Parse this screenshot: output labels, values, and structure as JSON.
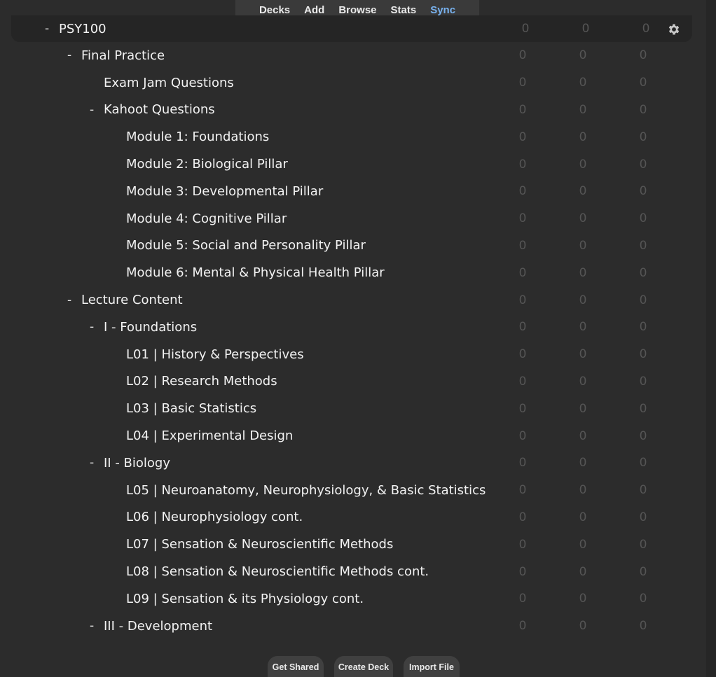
{
  "toolbar": {
    "items": [
      {
        "label": "Decks",
        "active": false
      },
      {
        "label": "Add",
        "active": false
      },
      {
        "label": "Browse",
        "active": false
      },
      {
        "label": "Stats",
        "active": false
      },
      {
        "label": "Sync",
        "active": true
      }
    ]
  },
  "decks": [
    {
      "label": "PSY100",
      "level": 0,
      "expanded": true,
      "counts": [
        "0",
        "0",
        "0"
      ]
    },
    {
      "label": "Final Practice",
      "level": 1,
      "expanded": true,
      "counts": [
        "0",
        "0",
        "0"
      ]
    },
    {
      "label": "Exam Jam Questions",
      "level": 2,
      "expanded": null,
      "counts": [
        "0",
        "0",
        "0"
      ]
    },
    {
      "label": "Kahoot Questions",
      "level": 2,
      "expanded": true,
      "counts": [
        "0",
        "0",
        "0"
      ]
    },
    {
      "label": "Module 1: Foundations",
      "level": 3,
      "expanded": null,
      "counts": [
        "0",
        "0",
        "0"
      ]
    },
    {
      "label": "Module 2: Biological Pillar",
      "level": 3,
      "expanded": null,
      "counts": [
        "0",
        "0",
        "0"
      ]
    },
    {
      "label": "Module 3: Developmental Pillar",
      "level": 3,
      "expanded": null,
      "counts": [
        "0",
        "0",
        "0"
      ]
    },
    {
      "label": "Module 4: Cognitive Pillar",
      "level": 3,
      "expanded": null,
      "counts": [
        "0",
        "0",
        "0"
      ]
    },
    {
      "label": "Module 5: Social and Personality Pillar",
      "level": 3,
      "expanded": null,
      "counts": [
        "0",
        "0",
        "0"
      ]
    },
    {
      "label": "Module 6: Mental & Physical Health Pillar",
      "level": 3,
      "expanded": null,
      "counts": [
        "0",
        "0",
        "0"
      ]
    },
    {
      "label": "Lecture Content",
      "level": 1,
      "expanded": true,
      "counts": [
        "0",
        "0",
        "0"
      ]
    },
    {
      "label": "I - Foundations",
      "level": 2,
      "expanded": true,
      "counts": [
        "0",
        "0",
        "0"
      ]
    },
    {
      "label": "L01 | History & Perspectives",
      "level": 3,
      "expanded": null,
      "counts": [
        "0",
        "0",
        "0"
      ]
    },
    {
      "label": "L02 | Research Methods",
      "level": 3,
      "expanded": null,
      "counts": [
        "0",
        "0",
        "0"
      ]
    },
    {
      "label": "L03 | Basic Statistics",
      "level": 3,
      "expanded": null,
      "counts": [
        "0",
        "0",
        "0"
      ]
    },
    {
      "label": "L04 | Experimental Design",
      "level": 3,
      "expanded": null,
      "counts": [
        "0",
        "0",
        "0"
      ]
    },
    {
      "label": "II - Biology",
      "level": 2,
      "expanded": true,
      "counts": [
        "0",
        "0",
        "0"
      ]
    },
    {
      "label": "L05 | Neuroanatomy, Neurophysiology, & Basic Statistics",
      "level": 3,
      "expanded": null,
      "counts": [
        "0",
        "0",
        "0"
      ]
    },
    {
      "label": "L06 | Neurophysiology cont.",
      "level": 3,
      "expanded": null,
      "counts": [
        "0",
        "0",
        "0"
      ]
    },
    {
      "label": "L07 | Sensation & Neuroscientific Methods",
      "level": 3,
      "expanded": null,
      "counts": [
        "0",
        "0",
        "0"
      ]
    },
    {
      "label": "L08 | Sensation & Neuroscientific Methods cont.",
      "level": 3,
      "expanded": null,
      "counts": [
        "0",
        "0",
        "0"
      ]
    },
    {
      "label": "L09 | Sensation & its Physiology cont.",
      "level": 3,
      "expanded": null,
      "counts": [
        "0",
        "0",
        "0"
      ]
    },
    {
      "label": "III - Development",
      "level": 2,
      "expanded": true,
      "counts": [
        "0",
        "0",
        "0"
      ]
    }
  ],
  "collapse_symbol": "-",
  "bottom_buttons": [
    {
      "label": "Get Shared"
    },
    {
      "label": "Create Deck"
    },
    {
      "label": "Import File"
    }
  ],
  "icons": {
    "options": "gear-icon"
  },
  "colors": {
    "accent": "#78b2ef",
    "background": "#2c2c2c",
    "count_zero": "#555555"
  }
}
